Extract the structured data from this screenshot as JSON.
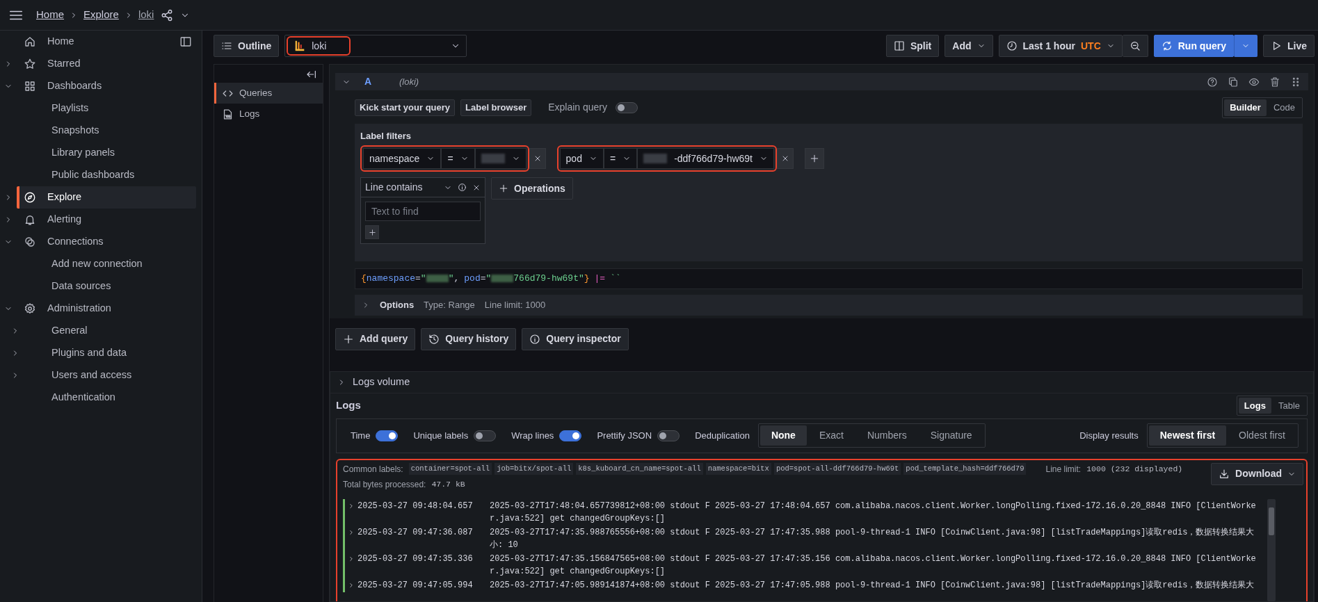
{
  "topbar": {
    "breadcrumbs": [
      "Home",
      "Explore",
      "loki"
    ]
  },
  "sidebar": {
    "items": [
      {
        "label": "Home",
        "selected": false
      },
      {
        "label": "Starred",
        "selected": false,
        "expanded": false
      },
      {
        "label": "Dashboards",
        "selected": false,
        "expanded": true,
        "children": [
          {
            "label": "Playlists",
            "selected": false
          },
          {
            "label": "Snapshots",
            "selected": false
          },
          {
            "label": "Library panels",
            "selected": false
          },
          {
            "label": "Public dashboards",
            "selected": false
          }
        ]
      },
      {
        "label": "Explore",
        "selected": true,
        "expanded": false
      },
      {
        "label": "Alerting",
        "selected": false,
        "expanded": false
      },
      {
        "label": "Connections",
        "selected": false,
        "expanded": true,
        "children": [
          {
            "label": "Add new connection",
            "selected": false
          },
          {
            "label": "Data sources",
            "selected": false
          }
        ]
      },
      {
        "label": "Administration",
        "selected": false,
        "expanded": true,
        "children": [
          {
            "label": "General",
            "selected": false,
            "expanded": false
          },
          {
            "label": "Plugins and data",
            "selected": false,
            "expanded": false
          },
          {
            "label": "Users and access",
            "selected": false,
            "expanded": false
          },
          {
            "label": "Authentication",
            "selected": false
          }
        ]
      }
    ]
  },
  "toolbar": {
    "outline": "Outline",
    "datasource": {
      "name": "loki",
      "highlighted": true
    },
    "split": "Split",
    "add": "Add",
    "time_range": "Last 1 hour",
    "timezone": "UTC",
    "run_query": "Run query",
    "live": "Live"
  },
  "outline": {
    "items": [
      {
        "label": "Queries",
        "selected": true
      },
      {
        "label": "Logs",
        "selected": false
      }
    ]
  },
  "query": {
    "letter": "A",
    "datasource": "(loki)",
    "expanded": true,
    "buttons": [
      "Kick start your query",
      "Label browser"
    ],
    "explain": {
      "label": "Explain query",
      "on": false
    },
    "modes": [
      {
        "label": "Builder",
        "selected": true
      },
      {
        "label": "Code",
        "selected": false
      }
    ],
    "label_filters": {
      "title": "Label filters",
      "filters": [
        {
          "label": "namespace",
          "operator": "=",
          "redacted": true,
          "highlighted": true
        },
        {
          "label": "pod",
          "operator": "=",
          "redacted": true,
          "value": "-ddf766d79-hw69t",
          "highlighted": true
        }
      ]
    },
    "line_contains": {
      "title": "Line contains",
      "placeholder": "Text to find"
    },
    "operations": "Operations",
    "code": [
      {
        "kind": "brace",
        "text": "{"
      },
      {
        "kind": "key",
        "text": "namespace"
      },
      {
        "kind": "op",
        "text": "="
      },
      {
        "kind": "string",
        "text": "\""
      },
      {
        "kind": "redacted"
      },
      {
        "kind": "string",
        "text": "\""
      },
      {
        "kind": "punct",
        "text": ","
      },
      {
        "kind": "key",
        "text": "pod"
      },
      {
        "kind": "op",
        "text": "="
      },
      {
        "kind": "string",
        "text": "\""
      },
      {
        "kind": "redacted"
      },
      {
        "kind": "string",
        "text": "766d79-hw69t\""
      },
      {
        "kind": "brace",
        "text": "}"
      },
      {
        "kind": "pipe",
        "text": "|="
      },
      {
        "kind": "string",
        "text": "``"
      }
    ],
    "options": {
      "title": "Options",
      "expanded": false,
      "type": "Type: Range",
      "line_limit": "Line limit: 1000"
    }
  },
  "actions": [
    "Add query",
    "Query history",
    "Query inspector"
  ],
  "logs_volume": {
    "title": "Logs volume",
    "expanded": false
  },
  "logs": {
    "title": "Logs",
    "views": [
      {
        "label": "Logs",
        "selected": true
      },
      {
        "label": "Table",
        "selected": false
      }
    ],
    "toggles": [
      {
        "label": "Time",
        "on": true
      },
      {
        "label": "Unique labels",
        "on": false
      },
      {
        "label": "Wrap lines",
        "on": true
      },
      {
        "label": "Prettify JSON",
        "on": false
      }
    ],
    "deduplication": {
      "label": "Deduplication",
      "options": [
        {
          "label": "None",
          "selected": true
        },
        {
          "label": "Exact",
          "selected": false
        },
        {
          "label": "Numbers",
          "selected": false
        },
        {
          "label": "Signature",
          "selected": false
        }
      ]
    },
    "display_results": {
      "label": "Display results",
      "options": [
        {
          "label": "Newest first",
          "selected": true
        },
        {
          "label": "Oldest first",
          "selected": false
        }
      ]
    },
    "highlighted": true,
    "common_labels": {
      "label": "Common labels:",
      "chips": [
        "container=spot-all",
        "job=bitx/spot-all",
        "k8s_kuboard_cn_name=spot-all",
        "namespace=bitx",
        "pod=spot-all-ddf766d79-hw69t",
        "pod_template_hash=ddf766d79"
      ]
    },
    "line_limit": {
      "label": "Line limit:",
      "value": "1000 (232 displayed)"
    },
    "total_bytes": {
      "label": "Total bytes processed:",
      "value": "47.7 kB"
    },
    "download": "Download",
    "rows": [
      {
        "time": "2025-03-27 09:48:04.657",
        "message": "2025-03-27T17:48:04.657739812+08:00 stdout F 2025-03-27 17:48:04.657 com.alibaba.nacos.client.Worker.longPolling.fixed-172.16.0.20_8848 INFO [ClientWorker.java:522] get changedGroupKeys:[]",
        "color": "#73bf69"
      },
      {
        "time": "2025-03-27 09:47:36.087",
        "message": "2025-03-27T17:47:35.988765556+08:00 stdout F 2025-03-27 17:47:35.988 pool-9-thread-1 INFO [CoinwClient.java:98] [listTradeMappings]读取redis，数据转换结果大小: 10",
        "color": "#73bf69"
      },
      {
        "time": "2025-03-27 09:47:35.336",
        "message": "2025-03-27T17:47:35.156847565+08:00 stdout F 2025-03-27 17:47:35.156 com.alibaba.nacos.client.Worker.longPolling.fixed-172.16.0.20_8848 INFO [ClientWorker.java:522] get changedGroupKeys:[]",
        "color": "#73bf69"
      },
      {
        "time": "2025-03-27 09:47:05.994",
        "message": "2025-03-27T17:47:05.989141874+08:00 stdout F 2025-03-27 17:47:05.988 pool-9-thread-1 INFO [CoinwClient.java:98] [listTradeMappings]读取redis，数据转换结果大",
        "color": "#73bf69"
      }
    ]
  }
}
